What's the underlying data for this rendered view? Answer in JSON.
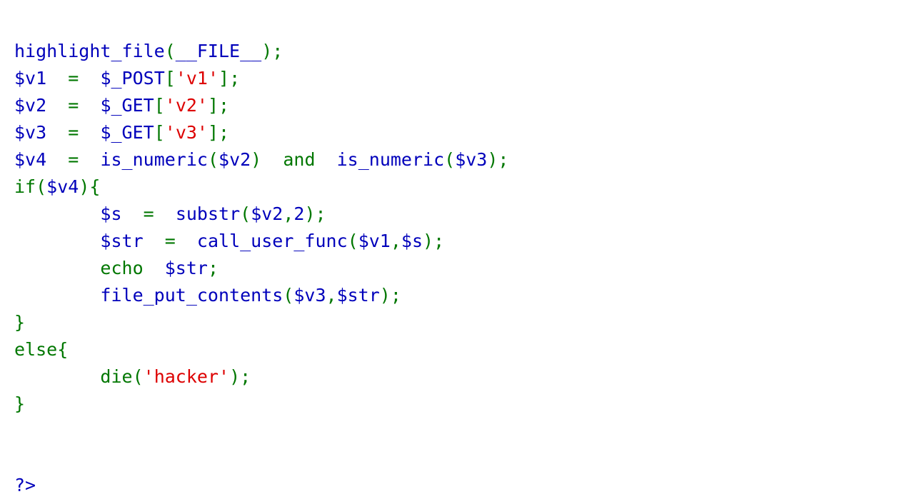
{
  "document": {
    "kind": "php-highlight-file-output",
    "background_color": "#FFFFFF"
  },
  "palette": {
    "default": "#0000BB",
    "keyword": "#007700",
    "string": "#DD0000",
    "comment": "#FF8000",
    "background": "#FFFFFF"
  },
  "code": {
    "language": "PHP",
    "lines": [
      {
        "index": 1,
        "text": "highlight_file(__FILE__);",
        "tokens": [
          {
            "t": "highlight_file",
            "c": "default"
          },
          {
            "t": "(",
            "c": "keyword"
          },
          {
            "t": "__FILE__",
            "c": "default"
          },
          {
            "t": ")",
            "c": "keyword"
          },
          {
            "t": ";",
            "c": "keyword"
          }
        ]
      },
      {
        "index": 2,
        "text": "$v1  =  $_POST['v1'];",
        "tokens": [
          {
            "t": "$v1",
            "c": "default"
          },
          {
            "t": "  ",
            "c": "default"
          },
          {
            "t": "=",
            "c": "keyword"
          },
          {
            "t": "  ",
            "c": "default"
          },
          {
            "t": "$_POST",
            "c": "default"
          },
          {
            "t": "[",
            "c": "keyword"
          },
          {
            "t": "'v1'",
            "c": "string"
          },
          {
            "t": "]",
            "c": "keyword"
          },
          {
            "t": ";",
            "c": "keyword"
          }
        ]
      },
      {
        "index": 3,
        "text": "$v2  =  $_GET['v2'];",
        "tokens": [
          {
            "t": "$v2",
            "c": "default"
          },
          {
            "t": "  ",
            "c": "default"
          },
          {
            "t": "=",
            "c": "keyword"
          },
          {
            "t": "  ",
            "c": "default"
          },
          {
            "t": "$_GET",
            "c": "default"
          },
          {
            "t": "[",
            "c": "keyword"
          },
          {
            "t": "'v2'",
            "c": "string"
          },
          {
            "t": "]",
            "c": "keyword"
          },
          {
            "t": ";",
            "c": "keyword"
          }
        ]
      },
      {
        "index": 4,
        "text": "$v3  =  $_GET['v3'];",
        "tokens": [
          {
            "t": "$v3",
            "c": "default"
          },
          {
            "t": "  ",
            "c": "default"
          },
          {
            "t": "=",
            "c": "keyword"
          },
          {
            "t": "  ",
            "c": "default"
          },
          {
            "t": "$_GET",
            "c": "default"
          },
          {
            "t": "[",
            "c": "keyword"
          },
          {
            "t": "'v3'",
            "c": "string"
          },
          {
            "t": "]",
            "c": "keyword"
          },
          {
            "t": ";",
            "c": "keyword"
          }
        ]
      },
      {
        "index": 5,
        "text": "$v4  =  is_numeric($v2)  and  is_numeric($v3);",
        "tokens": [
          {
            "t": "$v4",
            "c": "default"
          },
          {
            "t": "  ",
            "c": "default"
          },
          {
            "t": "=",
            "c": "keyword"
          },
          {
            "t": "  ",
            "c": "default"
          },
          {
            "t": "is_numeric",
            "c": "default"
          },
          {
            "t": "(",
            "c": "keyword"
          },
          {
            "t": "$v2",
            "c": "default"
          },
          {
            "t": ")",
            "c": "keyword"
          },
          {
            "t": "  ",
            "c": "default"
          },
          {
            "t": "and",
            "c": "keyword"
          },
          {
            "t": "  ",
            "c": "default"
          },
          {
            "t": "is_numeric",
            "c": "default"
          },
          {
            "t": "(",
            "c": "keyword"
          },
          {
            "t": "$v3",
            "c": "default"
          },
          {
            "t": ")",
            "c": "keyword"
          },
          {
            "t": ";",
            "c": "keyword"
          }
        ]
      },
      {
        "index": 6,
        "text": "if($v4){",
        "tokens": [
          {
            "t": "if",
            "c": "keyword"
          },
          {
            "t": "(",
            "c": "keyword"
          },
          {
            "t": "$v4",
            "c": "default"
          },
          {
            "t": ")",
            "c": "keyword"
          },
          {
            "t": "{",
            "c": "keyword"
          }
        ]
      },
      {
        "index": 7,
        "text": "        $s  =  substr($v2,2);",
        "tokens": [
          {
            "t": "        ",
            "c": "default"
          },
          {
            "t": "$s",
            "c": "default"
          },
          {
            "t": "  ",
            "c": "default"
          },
          {
            "t": "=",
            "c": "keyword"
          },
          {
            "t": "  ",
            "c": "default"
          },
          {
            "t": "substr",
            "c": "default"
          },
          {
            "t": "(",
            "c": "keyword"
          },
          {
            "t": "$v2",
            "c": "default"
          },
          {
            "t": ",",
            "c": "keyword"
          },
          {
            "t": "2",
            "c": "default"
          },
          {
            "t": ")",
            "c": "keyword"
          },
          {
            "t": ";",
            "c": "keyword"
          }
        ]
      },
      {
        "index": 8,
        "text": "        $str  =  call_user_func($v1,$s);",
        "tokens": [
          {
            "t": "        ",
            "c": "default"
          },
          {
            "t": "$str",
            "c": "default"
          },
          {
            "t": "  ",
            "c": "default"
          },
          {
            "t": "=",
            "c": "keyword"
          },
          {
            "t": "  ",
            "c": "default"
          },
          {
            "t": "call_user_func",
            "c": "default"
          },
          {
            "t": "(",
            "c": "keyword"
          },
          {
            "t": "$v1",
            "c": "default"
          },
          {
            "t": ",",
            "c": "keyword"
          },
          {
            "t": "$s",
            "c": "default"
          },
          {
            "t": ")",
            "c": "keyword"
          },
          {
            "t": ";",
            "c": "keyword"
          }
        ]
      },
      {
        "index": 9,
        "text": "        echo  $str;",
        "tokens": [
          {
            "t": "        ",
            "c": "default"
          },
          {
            "t": "echo",
            "c": "keyword"
          },
          {
            "t": "  ",
            "c": "default"
          },
          {
            "t": "$str",
            "c": "default"
          },
          {
            "t": ";",
            "c": "keyword"
          }
        ]
      },
      {
        "index": 10,
        "text": "        file_put_contents($v3,$str);",
        "tokens": [
          {
            "t": "        ",
            "c": "default"
          },
          {
            "t": "file_put_contents",
            "c": "default"
          },
          {
            "t": "(",
            "c": "keyword"
          },
          {
            "t": "$v3",
            "c": "default"
          },
          {
            "t": ",",
            "c": "keyword"
          },
          {
            "t": "$str",
            "c": "default"
          },
          {
            "t": ")",
            "c": "keyword"
          },
          {
            "t": ";",
            "c": "keyword"
          }
        ]
      },
      {
        "index": 11,
        "text": "}",
        "tokens": [
          {
            "t": "}",
            "c": "keyword"
          }
        ]
      },
      {
        "index": 12,
        "text": "else{",
        "tokens": [
          {
            "t": "else",
            "c": "keyword"
          },
          {
            "t": "{",
            "c": "keyword"
          }
        ]
      },
      {
        "index": 13,
        "text": "        die('hacker');",
        "tokens": [
          {
            "t": "        ",
            "c": "default"
          },
          {
            "t": "die",
            "c": "keyword"
          },
          {
            "t": "(",
            "c": "keyword"
          },
          {
            "t": "'hacker'",
            "c": "string"
          },
          {
            "t": ")",
            "c": "keyword"
          },
          {
            "t": ";",
            "c": "keyword"
          }
        ]
      },
      {
        "index": 14,
        "text": "}",
        "tokens": [
          {
            "t": "}",
            "c": "keyword"
          }
        ]
      },
      {
        "index": 15,
        "text": "",
        "tokens": []
      },
      {
        "index": 16,
        "text": "",
        "tokens": []
      },
      {
        "index": 17,
        "text": "?>",
        "tokens": [
          {
            "t": "?>",
            "c": "default"
          }
        ]
      }
    ]
  }
}
